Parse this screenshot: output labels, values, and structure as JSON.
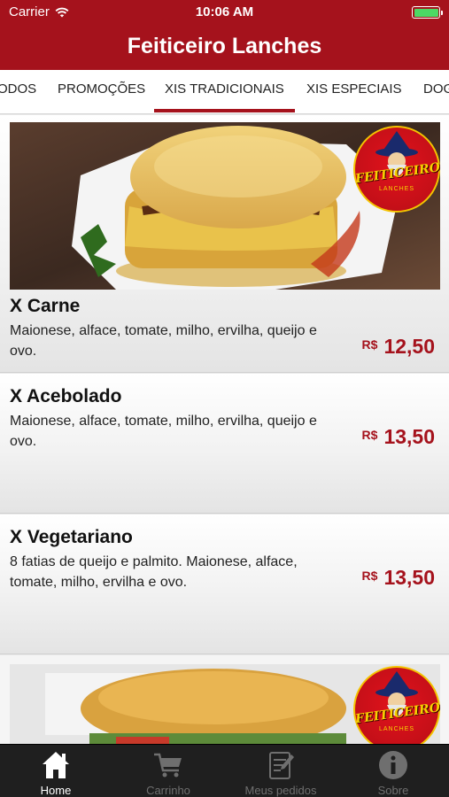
{
  "status": {
    "carrier": "Carrier",
    "time": "10:06 AM"
  },
  "header": {
    "title": "Feiticeiro Lanches"
  },
  "categories": [
    "ODOS",
    "PROMOÇÕES",
    "XIS TRADICIONAIS",
    "XIS ESPECIAIS",
    "DOG"
  ],
  "active_category": "XIS TRADICIONAIS",
  "logo": {
    "text": "Feiticeiro",
    "sub": "LANCHES"
  },
  "items": [
    {
      "name": "X Carne",
      "description": "Maionese, alface, tomate, milho, ervilha, queijo e ovo.",
      "currency": "R$",
      "price": "12,50"
    },
    {
      "name": "X Acebolado",
      "description": "Maionese, alface, tomate, milho, ervilha, queijo e ovo.",
      "currency": "R$",
      "price": "13,50"
    },
    {
      "name": "X Vegetariano",
      "description": "8 fatias de queijo e palmito. Maionese, alface, tomate, milho, ervilha e ovo.",
      "currency": "R$",
      "price": "13,50"
    }
  ],
  "tabbar": [
    {
      "label": "Home",
      "icon": "home-icon"
    },
    {
      "label": "Carrinho",
      "icon": "cart-icon"
    },
    {
      "label": "Meus pedidos",
      "icon": "orders-icon"
    },
    {
      "label": "Sobre",
      "icon": "info-icon"
    }
  ],
  "colors": {
    "brand": "#a5121c",
    "tabbar": "#1f1f1f",
    "battery": "#4cd964"
  }
}
